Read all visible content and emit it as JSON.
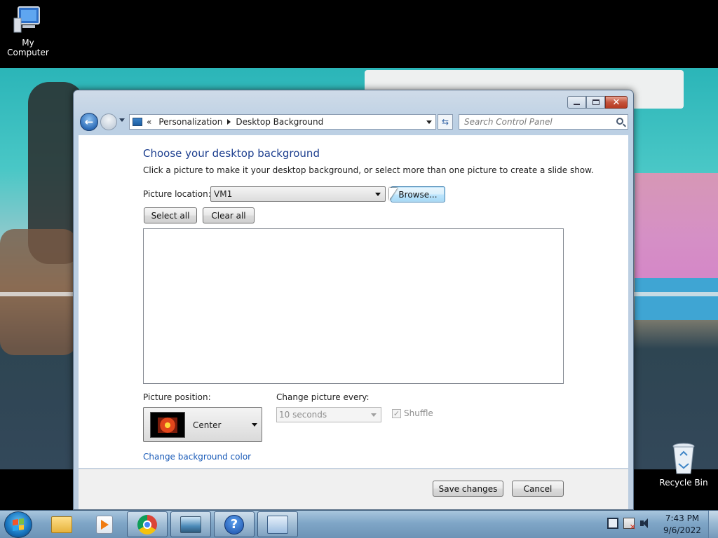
{
  "desktop": {
    "icons": [
      {
        "label": "My Computer",
        "icon": "computer-icon"
      },
      {
        "label": "Recycle Bin",
        "icon": "recycle-bin-icon"
      }
    ]
  },
  "window": {
    "breadcrumb": {
      "overflow": "«",
      "items": [
        "Personalization",
        "Desktop Background"
      ]
    },
    "search": {
      "placeholder": "Search Control Panel"
    },
    "heading": "Choose your desktop background",
    "subtext": "Click a picture to make it your desktop background, or select more than one picture to create a slide show.",
    "picture_location": {
      "label": "Picture location:",
      "value": "VM1",
      "browse_label": "Browse..."
    },
    "select_all_label": "Select all",
    "clear_all_label": "Clear all",
    "picture_position": {
      "label": "Picture position:",
      "value": "Center"
    },
    "change_picture": {
      "label": "Change picture every:",
      "value": "10 seconds",
      "enabled": false
    },
    "shuffle": {
      "label": "Shuffle",
      "checked": true,
      "enabled": false
    },
    "background_color_link": "Change background color",
    "footer": {
      "save_label": "Save changes",
      "cancel_label": "Cancel"
    }
  },
  "taskbar": {
    "pinned": [
      "windows-explorer-icon",
      "media-player-icon",
      "chrome-icon",
      "photo-viewer-icon",
      "help-icon",
      "control-panel-icon"
    ],
    "active": "control-panel-icon",
    "tray_icons": [
      "network-icon",
      "action-center-icon",
      "volume-icon"
    ],
    "clock": {
      "time": "7:43 PM",
      "date": "9/6/2022"
    }
  },
  "colors": {
    "heading_blue": "#1d3f8f",
    "link_blue": "#1a5bb8",
    "taskbar": "#7fa6c7"
  }
}
